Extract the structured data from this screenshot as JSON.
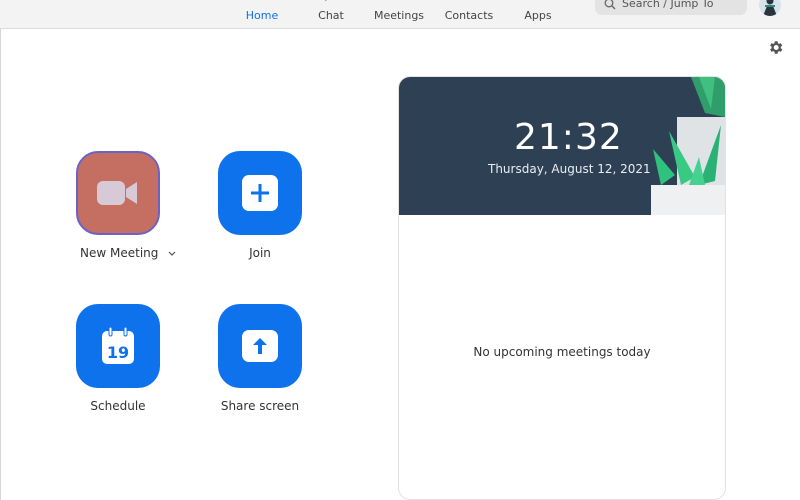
{
  "nav": {
    "items": [
      {
        "label": "Home",
        "icon": "home-icon"
      },
      {
        "label": "Chat",
        "icon": "chat-icon"
      },
      {
        "label": "Meetings",
        "icon": "clock-icon"
      },
      {
        "label": "Contacts",
        "icon": "contacts-icon"
      },
      {
        "label": "Apps",
        "icon": "apps-icon"
      }
    ],
    "active": "Home"
  },
  "search": {
    "placeholder": "Search / Jump To",
    "icon": "search-icon"
  },
  "settings": {
    "icon": "gear-icon"
  },
  "actions": {
    "new_meeting": {
      "label": "New Meeting",
      "icon": "video-camera-icon"
    },
    "join": {
      "label": "Join",
      "icon": "plus-icon"
    },
    "schedule": {
      "label": "Schedule",
      "icon": "calendar-icon",
      "day": "19"
    },
    "share_screen": {
      "label": "Share screen",
      "icon": "share-arrow-icon"
    }
  },
  "panel": {
    "time": "21:32",
    "date": "Thursday, August 12, 2021",
    "empty_message": "No upcoming meetings today"
  },
  "colors": {
    "accent": "#0e72ed",
    "new_meeting_bg": "#c56e62",
    "new_meeting_border": "#6a62c9",
    "banner_bg": "#2e4154"
  }
}
